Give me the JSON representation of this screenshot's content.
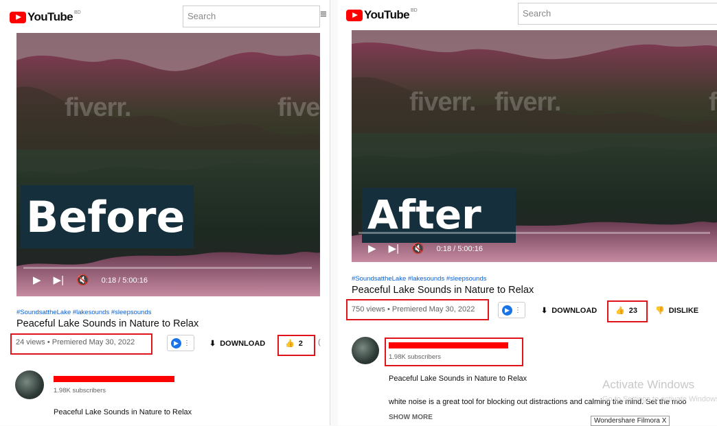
{
  "brand": {
    "name": "YouTube",
    "country_code": "BD"
  },
  "search": {
    "placeholder": "Search"
  },
  "watermark": "fiverr.",
  "video_title": "Peaceful Lake Sounds in Nature to Relax",
  "tags": "#SoundsattheLake #lakesounds #sleepsounds",
  "channel": {
    "subscribers": "1.98K subscribers",
    "redacted_name": true
  },
  "description": {
    "title_line": "Peaceful Lake Sounds in Nature to Relax",
    "body": "white noise is a great tool for blocking out distractions and calming the mind. Set the moo",
    "show_more": "SHOW MORE"
  },
  "before": {
    "overlay_label": "Before",
    "time": "0:18 / 5:00:16",
    "stats": "24 views • Premiered May 30, 2022",
    "download_label": "DOWNLOAD",
    "likes": "2",
    "edge_char": "("
  },
  "after": {
    "overlay_label": "After",
    "time": "0:18 / 5:00:16",
    "stats": "750 views • Premiered May 30, 2022",
    "download_label": "DOWNLOAD",
    "likes": "23",
    "dislike_label": "DISLIKE"
  },
  "overlay": {
    "activate_title": "Activate Windows",
    "activate_sub": "Go to Settings to activate Windows.",
    "filmora": "Wondershare Filmora X"
  },
  "colors": {
    "highlight": "#e0121a",
    "link": "#065fd4",
    "badge_bg": "#15303c",
    "brand_red": "#ff0000"
  }
}
